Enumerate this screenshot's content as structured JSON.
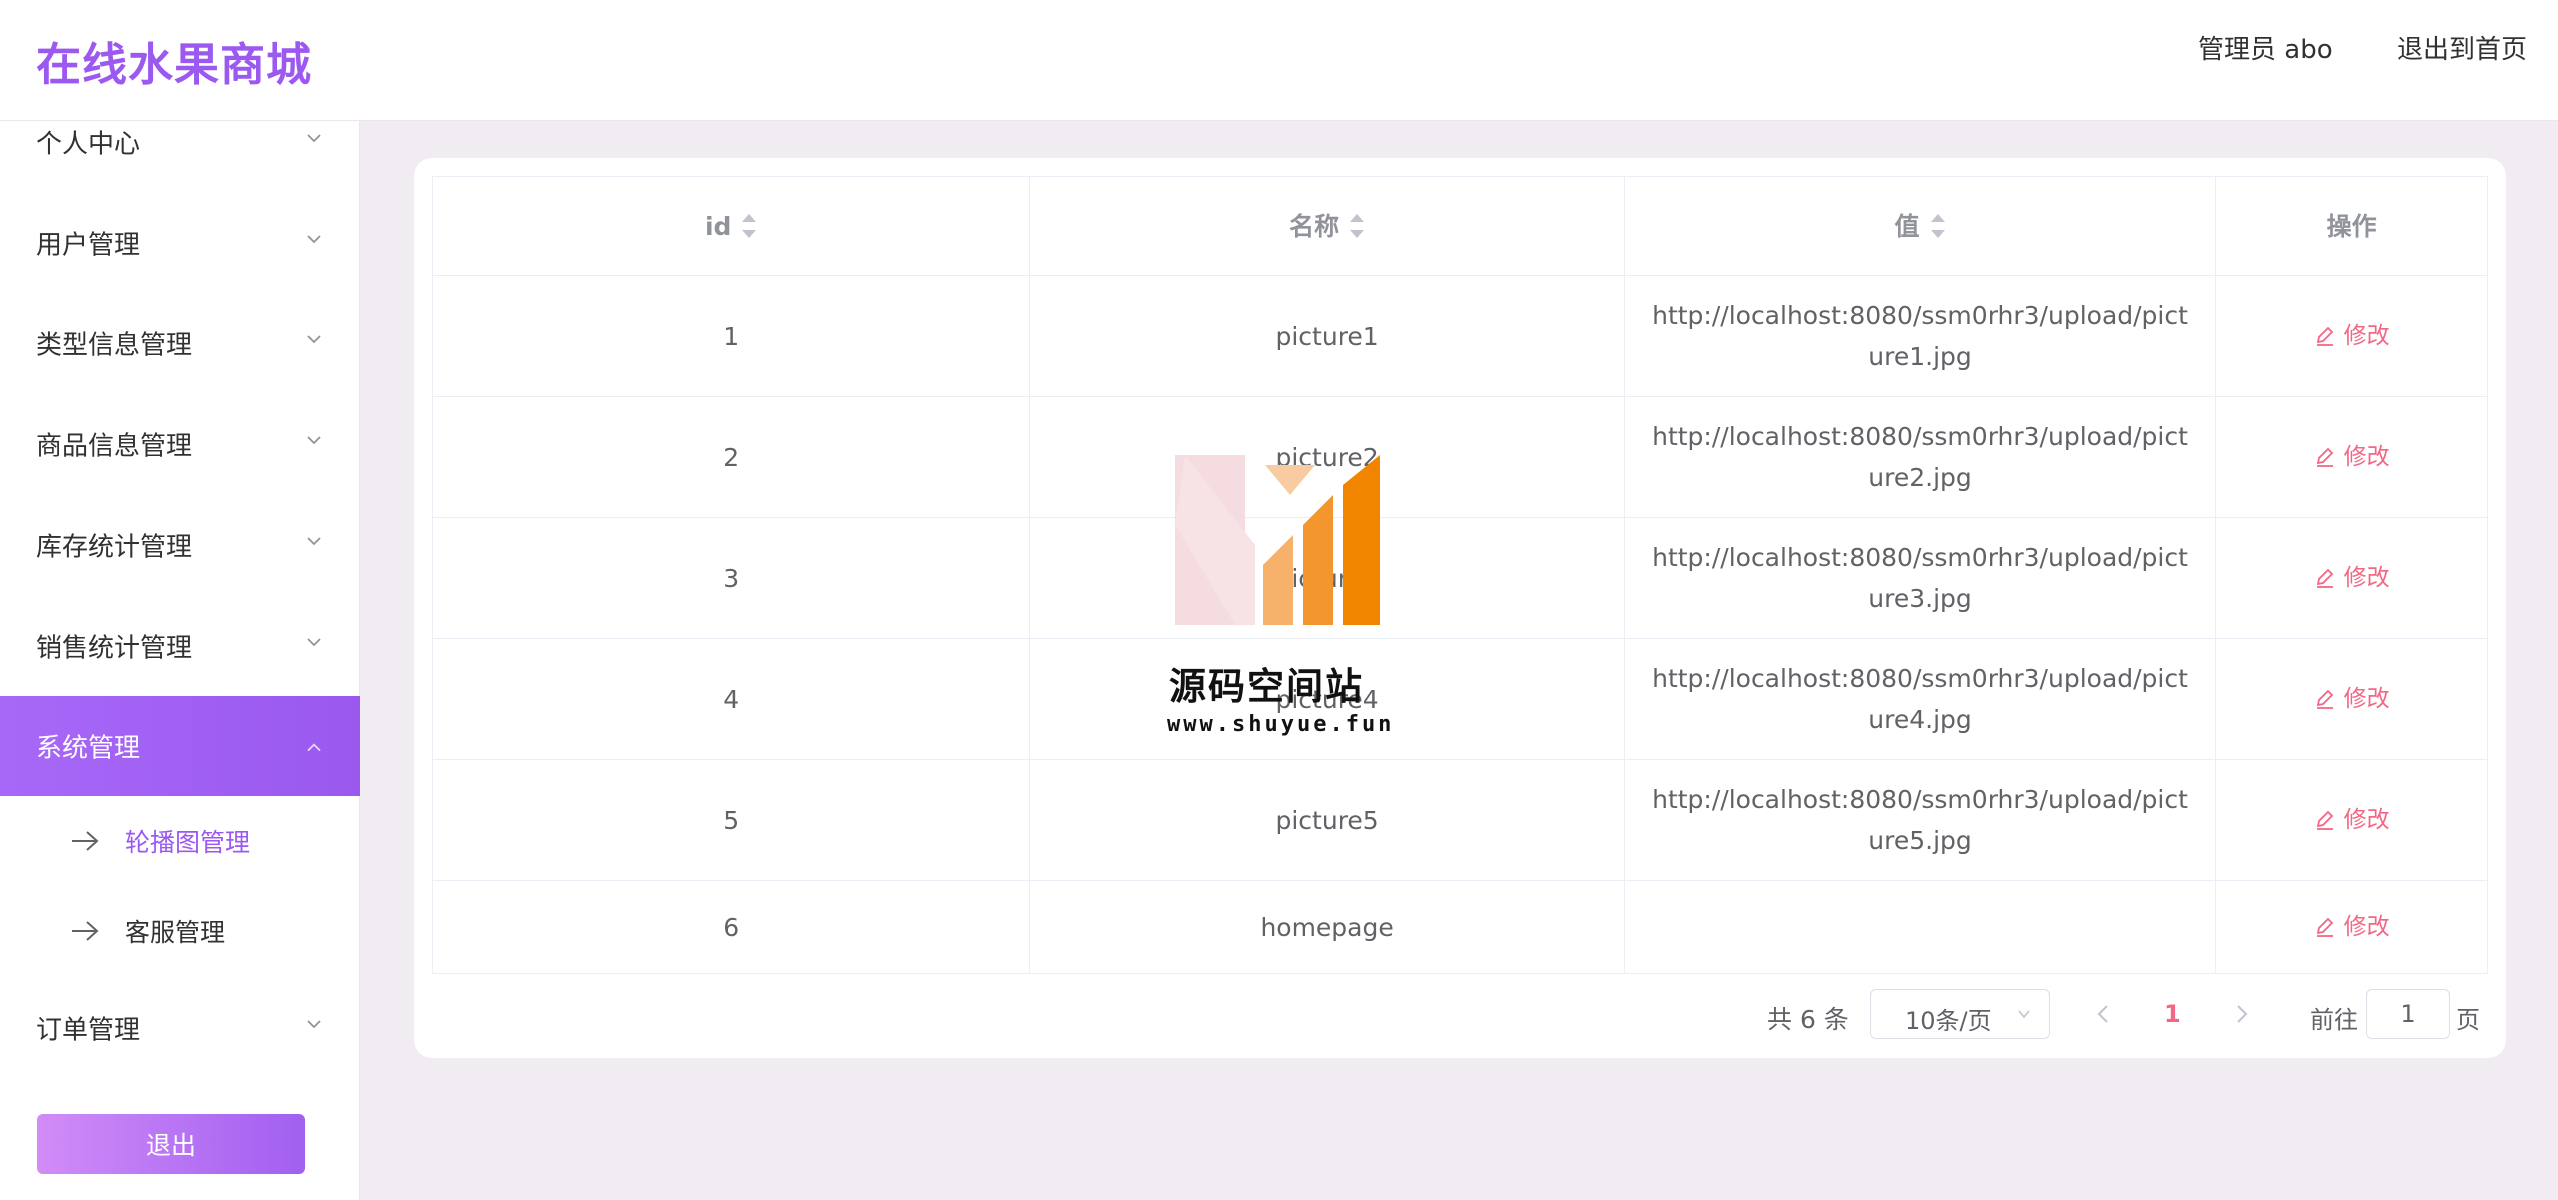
{
  "header": {
    "brand": "在线水果商城",
    "user": "管理员 abo",
    "home_link": "退出到首页"
  },
  "sidebar": {
    "items": [
      {
        "label": "个人中心"
      },
      {
        "label": "用户管理"
      },
      {
        "label": "类型信息管理"
      },
      {
        "label": "商品信息管理"
      },
      {
        "label": "库存统计管理"
      },
      {
        "label": "销售统计管理"
      },
      {
        "label": "系统管理"
      },
      {
        "label": "订单管理"
      }
    ],
    "sub_items": [
      {
        "label": "轮播图管理"
      },
      {
        "label": "客服管理"
      }
    ],
    "exit_label": "退出"
  },
  "table": {
    "headers": [
      "id",
      "名称",
      "值",
      "操作"
    ],
    "rows": [
      {
        "id": "1",
        "name": "picture1",
        "value": "http://localhost:8080/ssm0rhr3/upload/picture1.jpg"
      },
      {
        "id": "2",
        "name": "picture2",
        "value": "http://localhost:8080/ssm0rhr3/upload/picture2.jpg"
      },
      {
        "id": "3",
        "name": "picture3",
        "value": "http://localhost:8080/ssm0rhr3/upload/picture3.jpg"
      },
      {
        "id": "4",
        "name": "picture4",
        "value": "http://localhost:8080/ssm0rhr3/upload/picture4.jpg"
      },
      {
        "id": "5",
        "name": "picture5",
        "value": "http://localhost:8080/ssm0rhr3/upload/picture5.jpg"
      },
      {
        "id": "6",
        "name": "homepage",
        "value": ""
      }
    ],
    "edit_label": "修改"
  },
  "pagination": {
    "total": "共 6 条",
    "page_size": "10条/页",
    "current_page": "1",
    "goto_label": "前往",
    "goto_value": "1",
    "goto_suffix": "页"
  },
  "watermark": {
    "title": "源码空间站",
    "url": "www.shuyue.fun"
  },
  "colors": {
    "brand": "#9b59f0",
    "accent_pink": "#f36785",
    "active_menu": "#a868f7"
  }
}
